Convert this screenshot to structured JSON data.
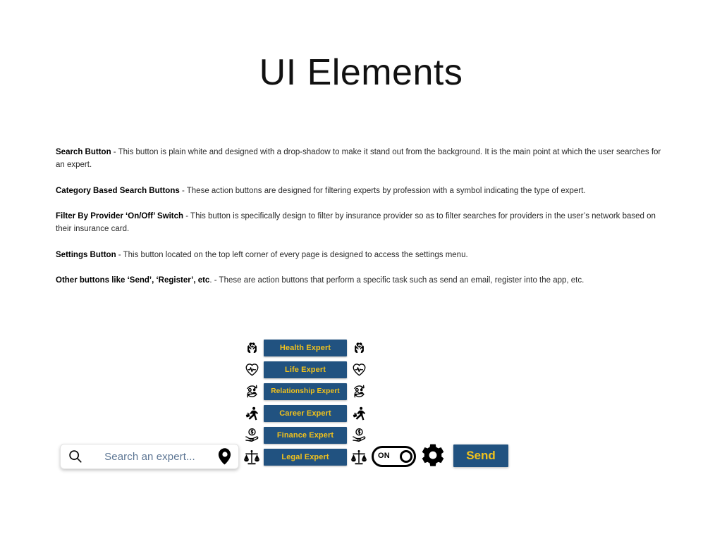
{
  "slide": {
    "title": "UI Elements"
  },
  "colors": {
    "button_blue": "#215280",
    "button_text_gold": "#f2c21c",
    "placeholder_blue": "#5d7694",
    "body_text": "#2b2b2b"
  },
  "descriptions": [
    {
      "term": "Search Button",
      "text": " - This button is plain white and designed with a drop-shadow to make it stand out from the background. It is the main point at which the user searches for an expert."
    },
    {
      "term": "Category Based Search Buttons",
      "text": " - These action buttons are designed for filtering experts by profession with a symbol indicating the type of expert."
    },
    {
      "term": "Filter By Provider ‘On/Off’ Switch",
      "text": " - This button is specifically design to filter by insurance provider so as to filter searches for providers in the user’s network based on their insurance card."
    },
    {
      "term": "Settings Button",
      "text": " - This button located on the top left corner of every page is designed to access the settings menu."
    },
    {
      "term": "Other buttons like ‘Send’, ‘Register’, etc",
      "text": ". - These are action buttons that perform a specific task such as send an email, register into the app, etc."
    }
  ],
  "mockup": {
    "search": {
      "placeholder": "Search an expert...",
      "value": "",
      "left_icon": "search-icon",
      "right_icon": "location-pin-icon"
    },
    "categories": [
      {
        "label": "Health Expert",
        "icon": "hands-holding-heart-icon"
      },
      {
        "label": "Life Expert",
        "icon": "heart-pulse-icon"
      },
      {
        "label": "Relationship Expert",
        "icon": "two-people-cycle-icon"
      },
      {
        "label": "Career Expert",
        "icon": "running-person-briefcase-icon"
      },
      {
        "label": "Finance Expert",
        "icon": "hand-coin-icon"
      },
      {
        "label": "Legal Expert",
        "icon": "scales-of-justice-icon"
      }
    ],
    "toggle": {
      "label": "ON",
      "state": "on"
    },
    "settings": {
      "icon": "gear-icon"
    },
    "send": {
      "label": "Send"
    }
  }
}
